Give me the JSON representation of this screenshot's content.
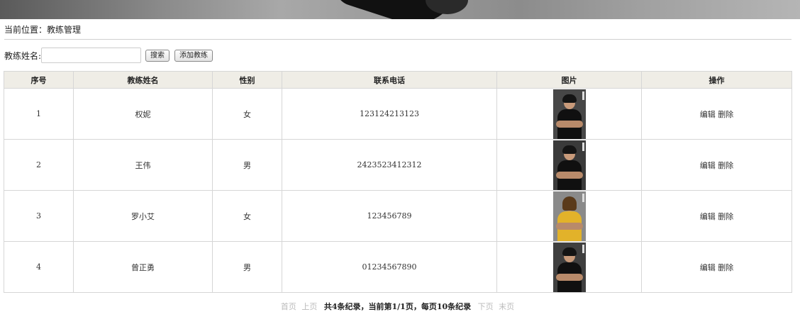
{
  "breadcrumb": {
    "label": "当前位置：",
    "current": "教练管理"
  },
  "search": {
    "label": "教练姓名:",
    "value": "",
    "search_button": "搜索",
    "add_button": "添加教练"
  },
  "table": {
    "headers": [
      "序号",
      "教练姓名",
      "性别",
      "联系电话",
      "图片",
      "操作"
    ],
    "rows": [
      {
        "id": "1",
        "name": "权妮",
        "gender": "女",
        "phone": "123124213123",
        "photo_bg": "#474747",
        "edit": "编辑",
        "delete": "删除"
      },
      {
        "id": "2",
        "name": "王伟",
        "gender": "男",
        "phone": "2423523412312",
        "photo_bg": "#3a3a3a",
        "edit": "编辑",
        "delete": "删除"
      },
      {
        "id": "3",
        "name": "罗小艾",
        "gender": "女",
        "phone": "123456789",
        "photo_bg": "#8a8a8a",
        "edit": "编辑",
        "delete": "删除"
      },
      {
        "id": "4",
        "name": "曾正勇",
        "gender": "男",
        "phone": "01234567890",
        "photo_bg": "#3f3f3f",
        "edit": "编辑",
        "delete": "删除"
      }
    ]
  },
  "pager": {
    "first": "首页",
    "prev": "上页",
    "info": "共4条纪录，当前第1/1页，每页10条纪录",
    "next": "下页",
    "last": "末页"
  }
}
